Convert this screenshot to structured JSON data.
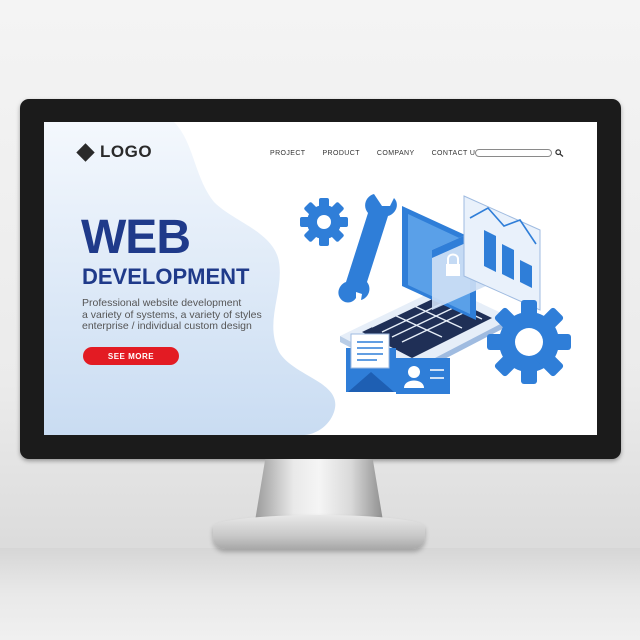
{
  "header": {
    "logo_text": "LOGO",
    "nav": [
      "PROJECT",
      "PRODUCT",
      "COMPANY",
      "CONTACT US"
    ],
    "search_icon": "search-icon"
  },
  "hero": {
    "title": "WEB",
    "subtitle": "DEVELOPMENT",
    "description": [
      "Professional website development",
      "a variety of systems, a variety of styles",
      "enterprise / individual custom design"
    ],
    "cta_label": "SEE MORE"
  },
  "colors": {
    "primary_blue": "#1f3a8a",
    "illustration_blue": "#2f7ed8",
    "light_blue": "#cfe0f5",
    "cta_red": "#e31b23"
  },
  "icons": [
    "gear-icon",
    "wrench-icon",
    "laptop-icon",
    "lock-icon",
    "chart-icon",
    "envelope-icon",
    "contact-card-icon"
  ]
}
